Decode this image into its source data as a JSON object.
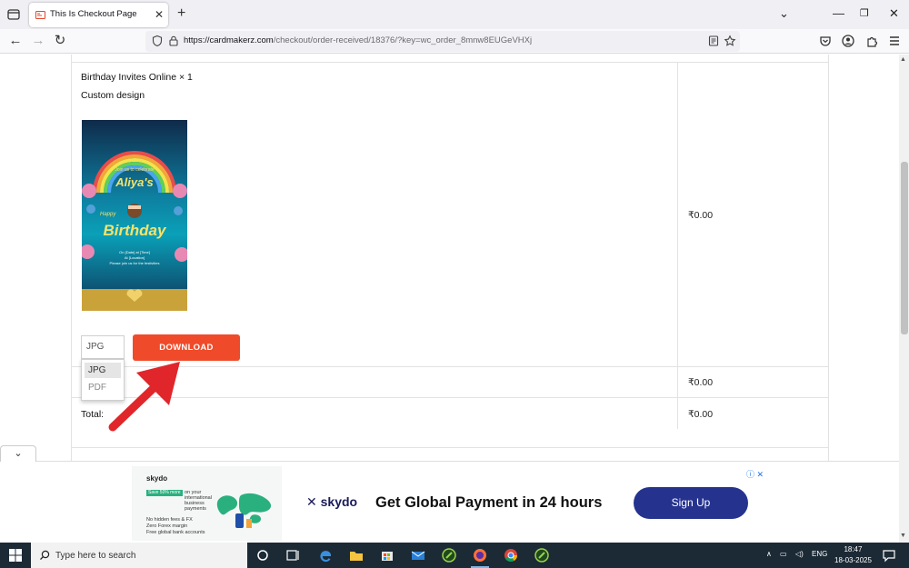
{
  "browser": {
    "tab_title": "This Is Checkout Page",
    "url_domain": "https://cardmakerz.com",
    "url_path": "/checkout/order-received/18376/?key=wc_order_8mnw8EUGeVHXj"
  },
  "order": {
    "product_name": "Birthday Invites Online × 1",
    "product_meta": "Custom design",
    "product_price": "₹0.00",
    "subtotal_price": "₹0.00",
    "total_label": "Total:",
    "total_price": "₹0.00",
    "format_select_value": "JPG",
    "format_options": [
      "JPG",
      "PDF"
    ],
    "download_label": "DOWNLOAD"
  },
  "card": {
    "line1": "Join us to celebrate",
    "name": "Aliya's",
    "happy": "Happy",
    "birthday": "Birthday",
    "details1": "On [Date] at [Time]",
    "details2": "At [Location]",
    "details3": "Please join us for the festivities"
  },
  "ad": {
    "small_brand": "skydo",
    "small_green": "Save 50% more",
    "small_text1": "on your international business payments",
    "small_bullets": [
      "No hidden fees & FX",
      "Zero Forex margin",
      "Free global bank accounts"
    ],
    "logo": "skydo",
    "headline": "Get Global Payment in 24 hours",
    "cta": "Sign Up"
  },
  "taskbar": {
    "search_placeholder": "Type here to search",
    "lang": "ENG",
    "time": "18:47",
    "date": "18-03-2025"
  },
  "colors": {
    "download_button": "#ef4b2a",
    "ad_cta": "#25338f",
    "taskbar": "#1c2a36"
  }
}
